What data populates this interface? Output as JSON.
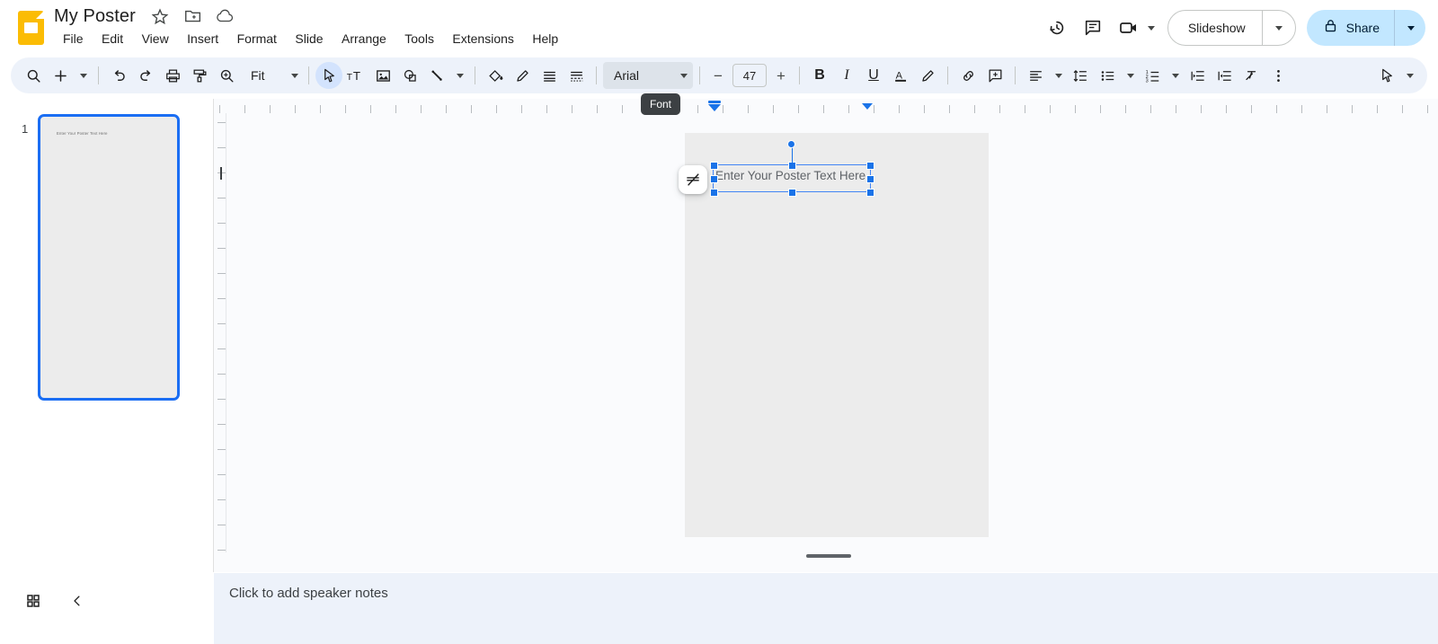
{
  "app": {
    "name": "Google Slides"
  },
  "titlebar": {
    "doc_title": "My Poster",
    "icons": [
      {
        "name": "star-icon",
        "label": "Star"
      },
      {
        "name": "move-to-folder-icon",
        "label": "Move"
      },
      {
        "name": "cloud-saved-icon",
        "label": "Saved to Drive"
      }
    ],
    "menus": [
      "File",
      "Edit",
      "View",
      "Insert",
      "Format",
      "Slide",
      "Arrange",
      "Tools",
      "Extensions",
      "Help"
    ],
    "right": {
      "history_icon": "history-icon",
      "comment_icon": "comment-icon",
      "meet_icon": "video-camera-icon",
      "slideshow_label": "Slideshow",
      "share_label": "Share",
      "share_bg": "#c2e7ff",
      "lock_icon": "lock-icon"
    }
  },
  "toolbar": {
    "zoom_value": "Fit",
    "font_name": "Arial",
    "font_size": "47",
    "decrease_label": "−",
    "increase_label": "+",
    "bold_label": "B",
    "italic_label": "I",
    "underline_label": "U",
    "text_color_label": "A",
    "tooltip": "Font",
    "items": [
      {
        "name": "search-icon",
        "label": "Search"
      },
      {
        "name": "new-slide-icon",
        "label": "New slide"
      },
      {
        "name": "undo-icon",
        "label": "Undo"
      },
      {
        "name": "redo-icon",
        "label": "Redo"
      },
      {
        "name": "print-icon",
        "label": "Print"
      },
      {
        "name": "paint-format-icon",
        "label": "Paint format"
      },
      {
        "name": "zoom-icon",
        "label": "Zoom"
      },
      {
        "name": "select-tool-icon",
        "label": "Select"
      },
      {
        "name": "text-box-icon",
        "label": "Text box"
      },
      {
        "name": "insert-image-icon",
        "label": "Image"
      },
      {
        "name": "shape-icon",
        "label": "Shape"
      },
      {
        "name": "line-icon",
        "label": "Line"
      },
      {
        "name": "fill-color-icon",
        "label": "Fill color"
      },
      {
        "name": "border-color-icon",
        "label": "Border color"
      },
      {
        "name": "border-weight-icon",
        "label": "Border weight"
      },
      {
        "name": "border-dash-icon",
        "label": "Border dash"
      },
      {
        "name": "highlight-icon",
        "label": "Highlight color"
      },
      {
        "name": "link-icon",
        "label": "Insert link"
      },
      {
        "name": "comment-icon",
        "label": "Add comment"
      },
      {
        "name": "align-icon",
        "label": "Align"
      },
      {
        "name": "line-spacing-icon",
        "label": "Line spacing"
      },
      {
        "name": "bulleted-list-icon",
        "label": "Bulleted list"
      },
      {
        "name": "numbered-list-icon",
        "label": "Numbered list"
      },
      {
        "name": "decrease-indent-icon",
        "label": "Decrease indent"
      },
      {
        "name": "increase-indent-icon",
        "label": "Increase indent"
      },
      {
        "name": "clear-formatting-icon",
        "label": "Clear formatting"
      },
      {
        "name": "more-options-icon",
        "label": "More"
      },
      {
        "name": "laser-pointer-icon",
        "label": "Pointer"
      }
    ]
  },
  "filmstrip": {
    "slide_number": "1",
    "thumb_text": "Enter Your Poster Text Here"
  },
  "canvas": {
    "textbox_value": "Enter Your Poster Text Here",
    "float_button_icon": "no-border-weight-icon",
    "accent_color": "#1a73e8",
    "slide_bg": "#ececec"
  },
  "bottom": {
    "grid_view_icon": "grid-view-icon",
    "collapse_icon": "chevron-left-icon",
    "notes_placeholder": "Click to add speaker notes"
  }
}
